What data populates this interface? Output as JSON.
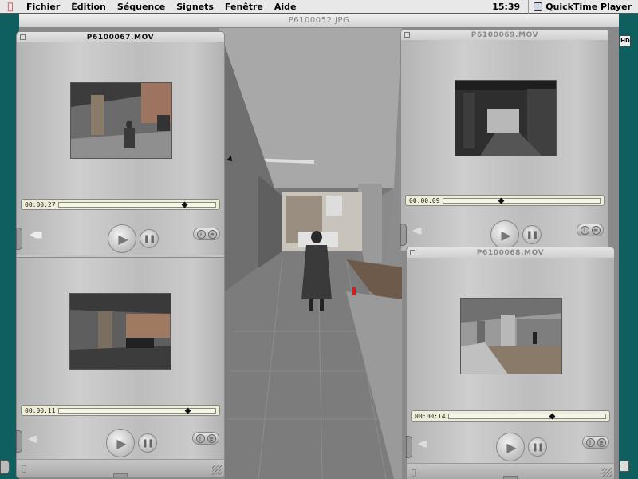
{
  "menubar": {
    "items": [
      "Fichier",
      "Édition",
      "Séquence",
      "Signets",
      "Fenêtre",
      "Aide"
    ],
    "clock": "15:39",
    "app_name": "QuickTime Player"
  },
  "background_window": {
    "title": "P6100052.JPG"
  },
  "movies": [
    {
      "title": "P6100067.MOV",
      "active": true,
      "timecode": "00:00:27",
      "progress": 0.8
    },
    {
      "title": "P6100069.MOV",
      "active": false,
      "timecode": "00:00:09",
      "progress": 0.37
    },
    {
      "title": "",
      "active": false,
      "timecode": "00:00:11",
      "progress": 0.82
    },
    {
      "title": "P6100068.MOV",
      "active": false,
      "timecode": "00:00:14",
      "progress": 0.66
    }
  ],
  "desktop": {
    "disk_label": "HD"
  },
  "colors": {
    "desktop": "#0f5f5f",
    "menubar": "#e8e8e8",
    "timebar": "#eeeed8"
  }
}
